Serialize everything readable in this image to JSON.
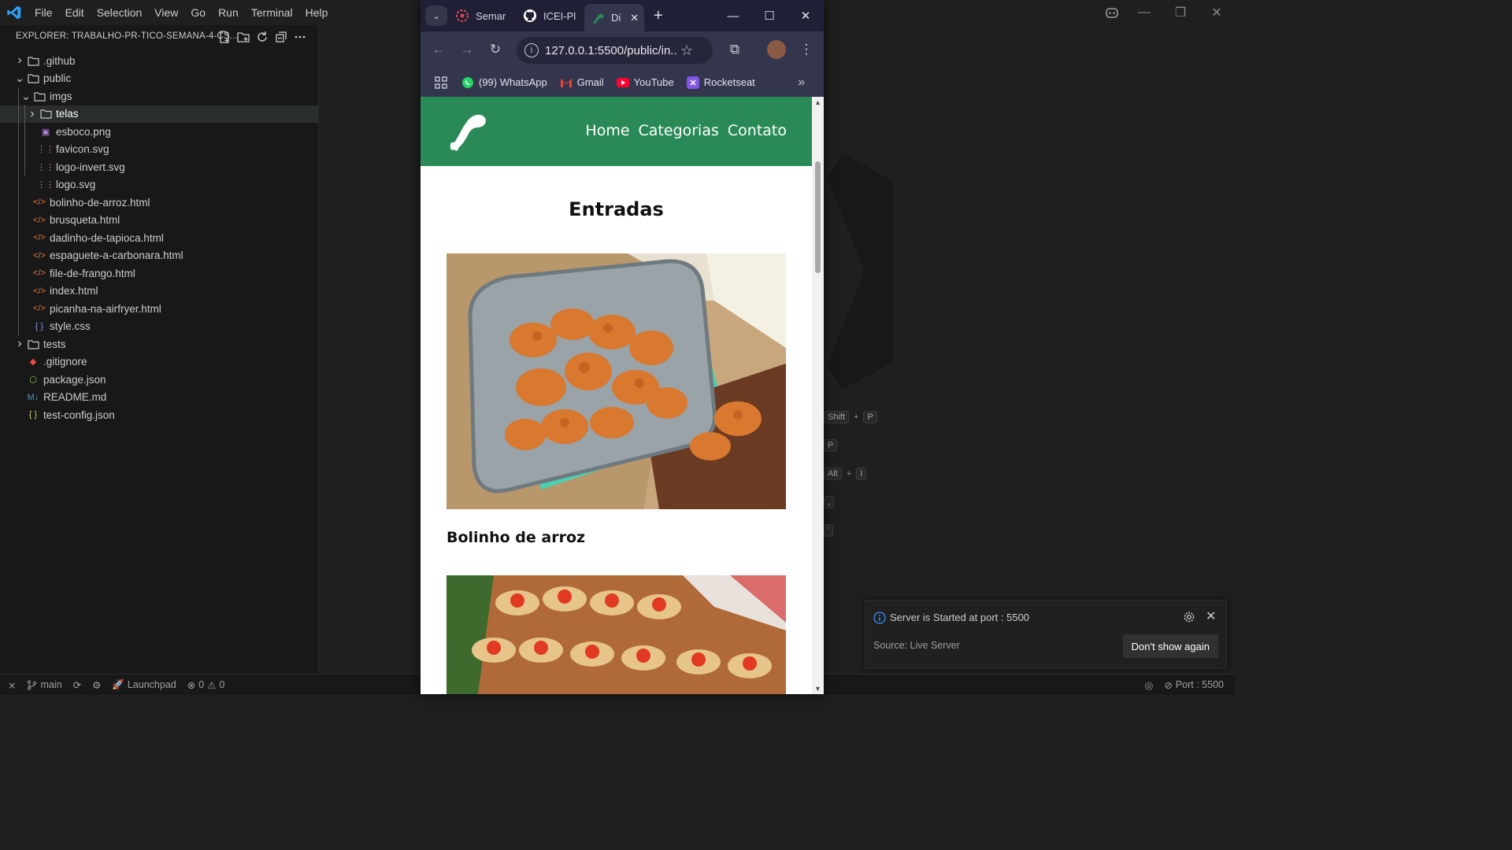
{
  "vscode": {
    "menu": [
      "File",
      "Edit",
      "Selection",
      "View",
      "Go",
      "Run",
      "Terminal",
      "Help"
    ],
    "explorer_title": "EXPLORER: TRABALHO-PR-TICO-SEMANA-4-CS...",
    "tree": [
      {
        "label": ".github",
        "type": "folder",
        "depth": 0,
        "open": false
      },
      {
        "label": "public",
        "type": "folder",
        "depth": 0,
        "open": true
      },
      {
        "label": "imgs",
        "type": "folder",
        "depth": 1,
        "open": true
      },
      {
        "label": "telas",
        "type": "folder",
        "depth": 2,
        "open": false,
        "selected": true
      },
      {
        "label": "esboco.png",
        "type": "image",
        "depth": 2
      },
      {
        "label": "favicon.svg",
        "type": "svg",
        "depth": 2
      },
      {
        "label": "logo-invert.svg",
        "type": "svg",
        "depth": 2
      },
      {
        "label": "logo.svg",
        "type": "svg",
        "depth": 2
      },
      {
        "label": "bolinho-de-arroz.html",
        "type": "html",
        "depth": 1
      },
      {
        "label": "brusqueta.html",
        "type": "html",
        "depth": 1
      },
      {
        "label": "dadinho-de-tapioca.html",
        "type": "html",
        "depth": 1
      },
      {
        "label": "espaguete-a-carbonara.html",
        "type": "html",
        "depth": 1
      },
      {
        "label": "file-de-frango.html",
        "type": "html",
        "depth": 1
      },
      {
        "label": "index.html",
        "type": "html",
        "depth": 1
      },
      {
        "label": "picanha-na-airfryer.html",
        "type": "html",
        "depth": 1
      },
      {
        "label": "style.css",
        "type": "css",
        "depth": 1
      },
      {
        "label": "tests",
        "type": "folder",
        "depth": 0,
        "open": false
      },
      {
        "label": ".gitignore",
        "type": "git",
        "depth": 0
      },
      {
        "label": "package.json",
        "type": "npm",
        "depth": 0
      },
      {
        "label": "README.md",
        "type": "md",
        "depth": 0
      },
      {
        "label": "test-config.json",
        "type": "json",
        "depth": 0
      }
    ],
    "shortcuts": [
      {
        "keys": [
          "Shift",
          "P"
        ]
      },
      {
        "keys": [
          "P"
        ]
      },
      {
        "keys": [
          "Alt",
          "I"
        ]
      },
      {
        "keys": [
          ","
        ]
      },
      {
        "keys": [
          "'"
        ]
      }
    ],
    "status": {
      "branch": "main",
      "launchpad": "Launchpad",
      "errors": "0",
      "warnings": "0",
      "port": "Port : 5500"
    },
    "notification": {
      "message": "Server is Started at port : 5500",
      "source": "Source: Live Server",
      "button": "Don't show again"
    }
  },
  "browser": {
    "tabs": [
      {
        "title": "Semar",
        "icon": "semana-icon"
      },
      {
        "title": "ICEI-Pl",
        "icon": "github-icon"
      },
      {
        "title": "Di",
        "icon": "site-logo-icon",
        "active": true
      }
    ],
    "url": "127.0.0.1:5500/public/in...",
    "bookmarks": [
      "(99) WhatsApp",
      "Gmail",
      "YouTube",
      "Rocketseat"
    ],
    "colors": {
      "frame": "#1f2036",
      "toolbar": "#34364e",
      "site_header": "#2a8a57"
    },
    "site": {
      "nav": [
        "Home",
        "Categorias",
        "Contato"
      ],
      "section_title": "Entradas",
      "recipes": [
        "Bolinho de arroz"
      ]
    }
  }
}
